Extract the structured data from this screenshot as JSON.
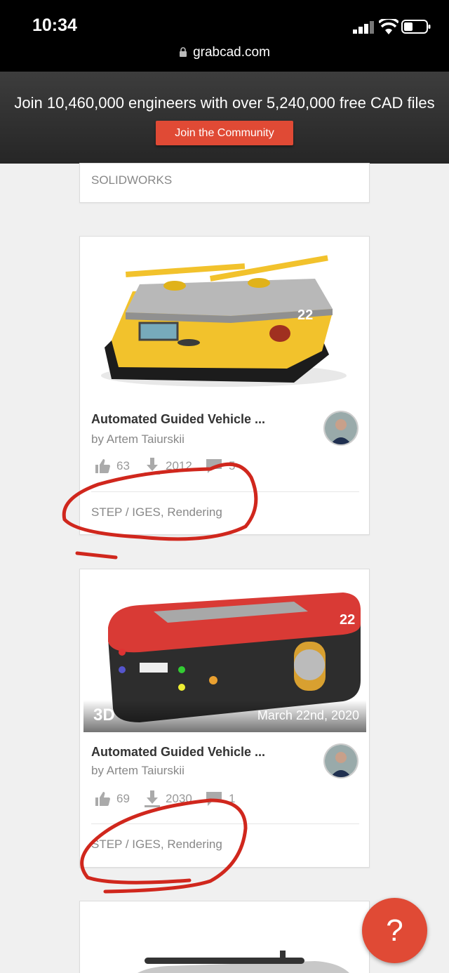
{
  "status": {
    "time": "10:34",
    "url": "grabcad.com"
  },
  "banner": {
    "text": "Join 10,460,000 engineers with over 5,240,000 free CAD files",
    "button": "Join the Community"
  },
  "cards": [
    {
      "tags": "SOLIDWORKS"
    },
    {
      "title": "Automated Guided Vehicle ...",
      "author": "by Artem Taiurskii",
      "likes": "63",
      "downloads": "2012",
      "comments": "5",
      "tags": "STEP / IGES, Rendering"
    },
    {
      "title": "Automated Guided Vehicle ...",
      "author": "by Artem Taiurskii",
      "likes": "69",
      "downloads": "2030",
      "comments": "1",
      "tags": "STEP / IGES, Rendering",
      "badge": "3D",
      "date": "March 22nd, 2020"
    }
  ],
  "help": "?",
  "colors": {
    "accent": "#e04a35",
    "annotation": "#d0271d"
  },
  "icons": [
    "lock-icon",
    "like-icon",
    "download-icon",
    "comment-icon",
    "help-icon"
  ]
}
